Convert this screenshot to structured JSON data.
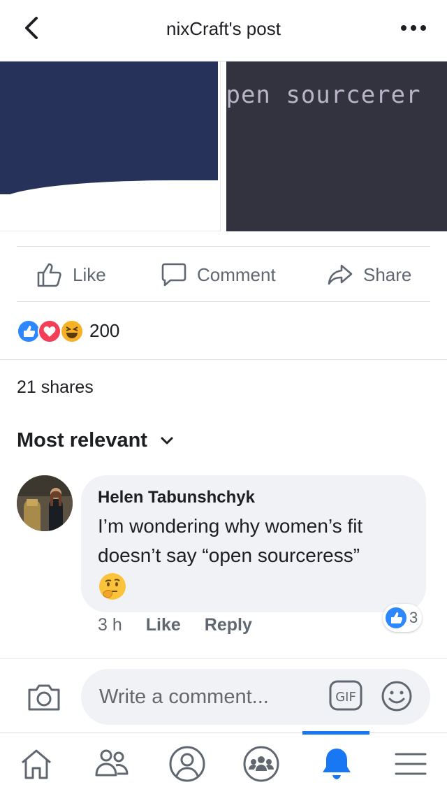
{
  "header": {
    "title": "nixCraft's post"
  },
  "post_image": {
    "right_text": "open sourcerer"
  },
  "actions": {
    "like": "Like",
    "comment": "Comment",
    "share": "Share"
  },
  "reactions": {
    "icons": [
      "like-icon",
      "love-icon",
      "haha-icon"
    ],
    "count": "200"
  },
  "shares": "21 shares",
  "comments_sort": {
    "label": "Most relevant"
  },
  "comment": {
    "author": "Helen Tabunshchyk",
    "text": "I’m wondering why women’s fit doesn’t say “open sourceress”",
    "emoji": "thinking-face-icon",
    "time": "3 h",
    "like": "Like",
    "reply": "Reply",
    "reaction_count": "3"
  },
  "composer": {
    "placeholder": "Write a comment..."
  },
  "bottom_nav": {
    "items": [
      "home-icon",
      "friends-icon",
      "profile-icon",
      "groups-icon",
      "notifications-icon",
      "menu-icon"
    ],
    "active": "notifications-icon"
  },
  "colors": {
    "accent": "#1877f2",
    "like_blue": "#2d88ff",
    "love_red": "#f33e58",
    "haha_yellow": "#f7b125",
    "bubble_bg": "#f0f2f5"
  }
}
